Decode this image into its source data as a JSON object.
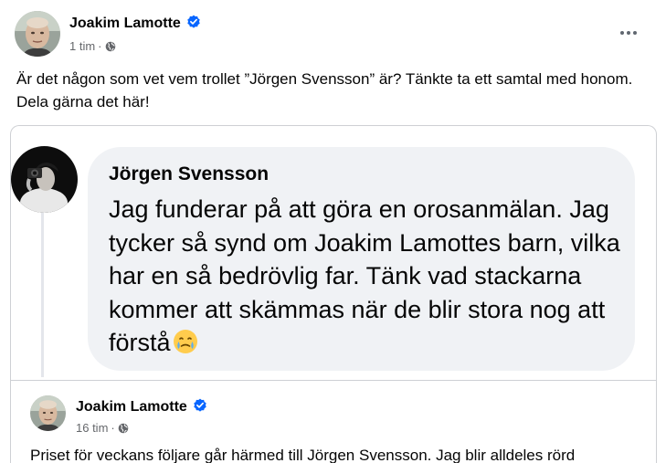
{
  "post": {
    "author": "Joakim Lamotte",
    "time": "1 tim",
    "separator": "·",
    "privacy_icon": "globe-icon",
    "verified_icon": "verified-badge-icon",
    "more_icon": "more-options-icon",
    "text": "Är det någon som vet vem trollet ”Jörgen Svensson” är? Tänkte ta ett samtal med honom. Dela gärna det här!"
  },
  "comment": {
    "author": "Jörgen Svensson",
    "text": "Jag funderar på att göra en orosanmälan. Jag tycker så synd om Joakim Lamottes barn, vilka har en så bedrövlig far. Tänk vad stackarna kommer att skämmas när de blir stora nog att förstå",
    "emoji_icon": "face-holding-back-tears-emoji"
  },
  "shared_post": {
    "author": "Joakim Lamotte",
    "time": "16 tim",
    "separator": "·",
    "privacy_icon": "globe-icon",
    "verified_icon": "verified-badge-icon",
    "text": "Priset för veckans följare går härmed till Jörgen Svensson. Jag blir alldeles rörd"
  },
  "colors": {
    "verified_blue": "#0866ff",
    "secondary_text": "#65676b",
    "bubble_bg": "#f0f2f5",
    "border": "#ced0d4"
  }
}
